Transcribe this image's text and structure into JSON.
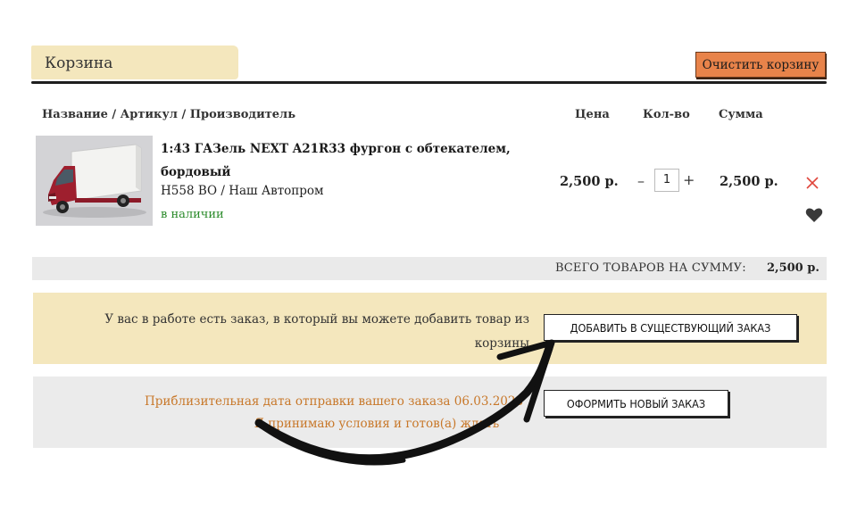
{
  "header": {
    "title": "Корзина",
    "clear_button": "Очистить корзину"
  },
  "columns": {
    "name": "Название / Артикул / Производитель",
    "price": "Цена",
    "qty": "Кол-во",
    "sum": "Сумма"
  },
  "item": {
    "name": "1:43 ГАЗель NEXT A21R33 фургон с обтекателем, бордовый",
    "sku": "H558 BO / Наш Автопром",
    "stock": "в наличии",
    "price": "2,500 р.",
    "qty_minus": "–",
    "qty": "1",
    "qty_plus": "+",
    "sum": "2,500 р."
  },
  "total": {
    "label": "ВСЕГО ТОВАРОВ НА СУММУ:",
    "value": "2,500 р."
  },
  "existing_order": {
    "message": "У вас в работе есть заказ, в который вы можете добавить товар из корзины",
    "button": "ДОБАВИТЬ В СУЩЕСТВУЮЩИЙ ЗАКАЗ"
  },
  "new_order": {
    "ship_date": "Приблизительная дата отправки вашего заказа 06.03.2023",
    "accept": "Я принимаю условия и готов(а) ждать",
    "button": "ОФОРМИТЬ НОВЫЙ ЗАКАЗ"
  },
  "icons": {
    "remove": "close-icon",
    "favorite": "heart-icon"
  },
  "colors": {
    "title_bg": "#f4e7bd",
    "clear_button": "#e8834a",
    "in_stock": "#2a8a2a",
    "ship_text": "#c8782a",
    "remove_icon": "#e0463c"
  }
}
